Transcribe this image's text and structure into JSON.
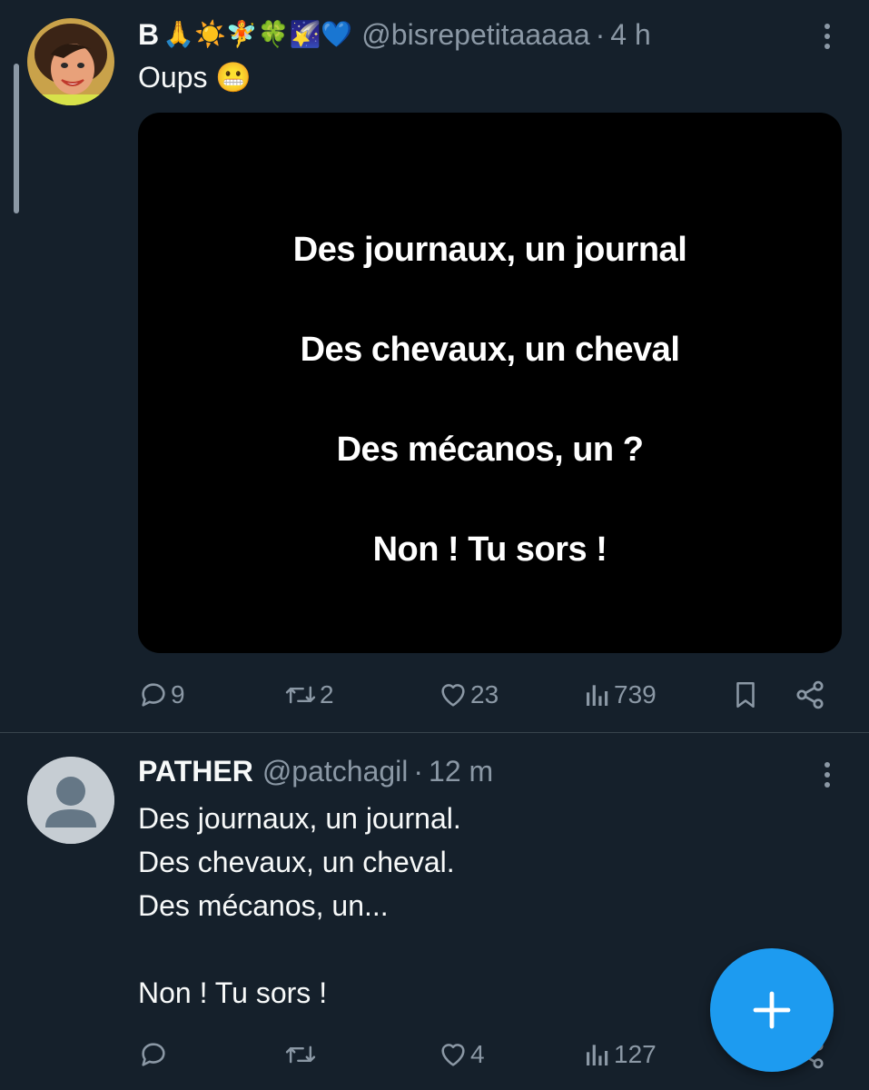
{
  "tweets": [
    {
      "display_name": "B",
      "name_emojis": "🙏☀️🧚🍀🌠💙",
      "handle": "@bisrepetitaaaaa",
      "separator": "·",
      "time": "4 h",
      "text": "Oups 😬",
      "media_lines": [
        "Des journaux, un journal",
        "Des chevaux, un cheval",
        "Des mécanos, un ?",
        "Non ! Tu sors !"
      ],
      "replies": "9",
      "retweets": "2",
      "likes": "23",
      "views": "739"
    },
    {
      "display_name": "PATHER",
      "handle": "@patchagil",
      "separator": "·",
      "time": "12 m",
      "text": "Des journaux, un journal.\nDes chevaux, un cheval.\nDes mécanos, un...\n\nNon ! Tu sors !",
      "replies": "",
      "retweets": "",
      "likes": "4",
      "views": "127"
    }
  ],
  "fab": {
    "icon": "plus-icon"
  },
  "colors": {
    "background": "#15202b",
    "text": "#f7f9f9",
    "secondary": "#8b98a5",
    "accent": "#1d9bf0",
    "divider": "#38444d"
  }
}
